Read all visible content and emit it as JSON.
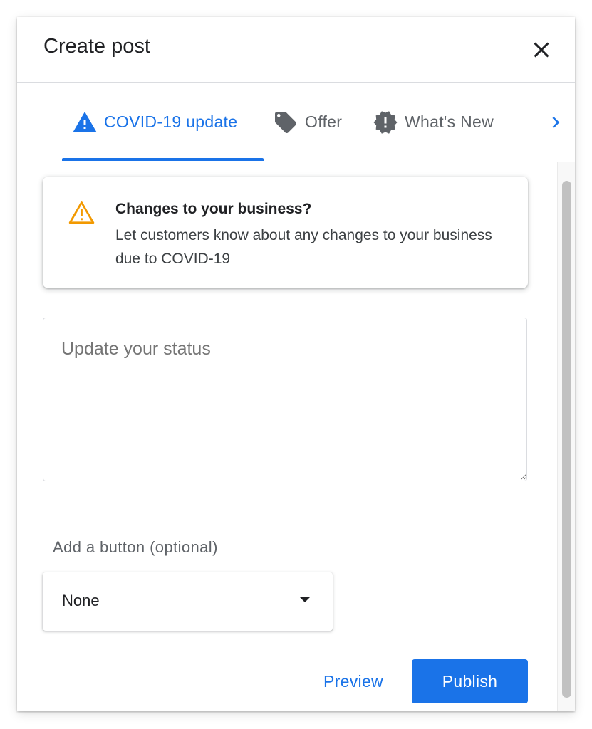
{
  "dialog": {
    "title": "Create post",
    "close_icon": "close-icon"
  },
  "tabs": [
    {
      "label": "COVID-19 update",
      "icon": "warning-triangle-icon",
      "active": true
    },
    {
      "label": "Offer",
      "icon": "tag-icon",
      "active": false
    },
    {
      "label": "What's New",
      "icon": "announcement-badge-icon",
      "active": false
    }
  ],
  "tabs_next_icon": "chevron-right-icon",
  "info_card": {
    "icon": "warning-outline-icon",
    "title": "Changes to your business?",
    "body": "Let customers know about any changes to your business due to COVID-19"
  },
  "status": {
    "placeholder": "Update your status",
    "value": ""
  },
  "button_field": {
    "label": "Add a button (optional)",
    "selected": "None"
  },
  "actions": {
    "preview_label": "Preview",
    "publish_label": "Publish"
  },
  "colors": {
    "accent": "#1a73e8",
    "warning": "#f29900",
    "text_primary": "#202124",
    "text_secondary": "#5f6368"
  }
}
